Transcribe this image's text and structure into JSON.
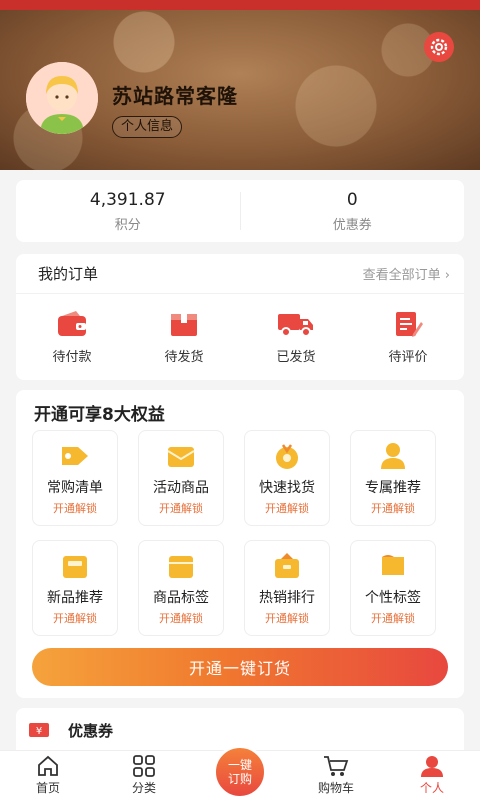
{
  "user": {
    "name": "苏站路常客隆",
    "profile_label": "个人信息"
  },
  "stats": [
    {
      "value": "4,391.87",
      "label": "积分"
    },
    {
      "value": "0",
      "label": "优惠券"
    }
  ],
  "orders": {
    "title": "我的订单",
    "view_all": "查看全部订单 ›",
    "items": [
      {
        "label": "待付款",
        "icon": "wallet-icon"
      },
      {
        "label": "待发货",
        "icon": "package-icon"
      },
      {
        "label": "已发货",
        "icon": "truck-icon"
      },
      {
        "label": "待评价",
        "icon": "review-icon"
      }
    ]
  },
  "benefits": {
    "title": "开通可享8大权益",
    "unlock_label": "开通解锁",
    "items": [
      {
        "label": "常购清单",
        "icon": "tag-icon"
      },
      {
        "label": "活动商品",
        "icon": "gift-icon"
      },
      {
        "label": "快速找货",
        "icon": "magic-icon"
      },
      {
        "label": "专属推荐",
        "icon": "person-icon"
      },
      {
        "label": "新品推荐",
        "icon": "new-box-icon"
      },
      {
        "label": "商品标签",
        "icon": "label-box-icon"
      },
      {
        "label": "热销排行",
        "icon": "rank-box-icon"
      },
      {
        "label": "个性标签",
        "icon": "flag-icon"
      }
    ],
    "cta": "开通一键订货"
  },
  "coupon_section": {
    "title": "优惠券",
    "badge": "¥"
  },
  "tabbar": {
    "tabs": [
      {
        "label": "首页",
        "icon": "home-icon"
      },
      {
        "label": "分类",
        "icon": "grid-icon"
      },
      {
        "label": "一键订购",
        "icon": "quick-order-icon"
      },
      {
        "label": "购物车",
        "icon": "cart-icon"
      },
      {
        "label": "个人",
        "icon": "person-icon"
      }
    ],
    "center_line1": "一键",
    "center_line2": "订购",
    "active": "个人"
  },
  "colors": {
    "accent": "#e8483f",
    "orange": "#f0792f",
    "gold": "#f5b82e",
    "header_brown": "#8a5c38"
  }
}
